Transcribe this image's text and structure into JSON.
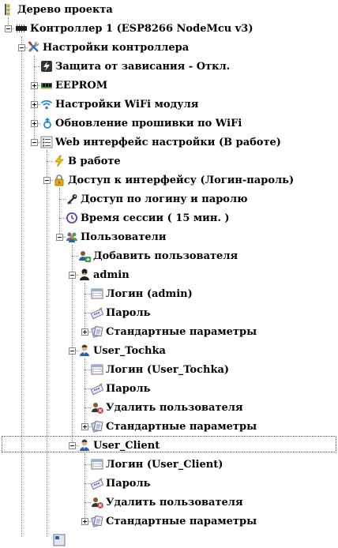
{
  "tree": {
    "root_label": "Дерево проекта",
    "controller": "Контроллер 1 (ESP8266 NodeMcu v3)",
    "settings": "Настройки контроллера",
    "watchdog": "Защита от зависания - Откл.",
    "eeprom": "EEPROM",
    "wifi": "Настройки WiFi модуля",
    "ota": "Обновление прошивки по WiFi",
    "web": "Web интерфейс настройки (В работе)",
    "working": "В работе",
    "access": "Доступ к интерфейсу (Логин-пароль)",
    "access_login": "Доступ по логину и паролю",
    "session": "Время сессии ( 15 мин. )",
    "users": "Пользователи",
    "add_user": "Добавить пользователя",
    "u_admin": "admin",
    "admin_login": "Логин (admin)",
    "admin_pass": "Пароль",
    "admin_std": "Стандартные параметры",
    "u_tochka": "User_Tochka",
    "tochka_login": "Логин (User_Tochka)",
    "tochka_pass": "Пароль",
    "tochka_del": "Удалить пользователя",
    "tochka_std": "Стандартные параметры",
    "u_client": "User_Client",
    "client_login": "Логин (User_Client)",
    "client_pass": "Пароль",
    "client_del": "Удалить пользователя",
    "client_std": "Стандартные параметры"
  }
}
